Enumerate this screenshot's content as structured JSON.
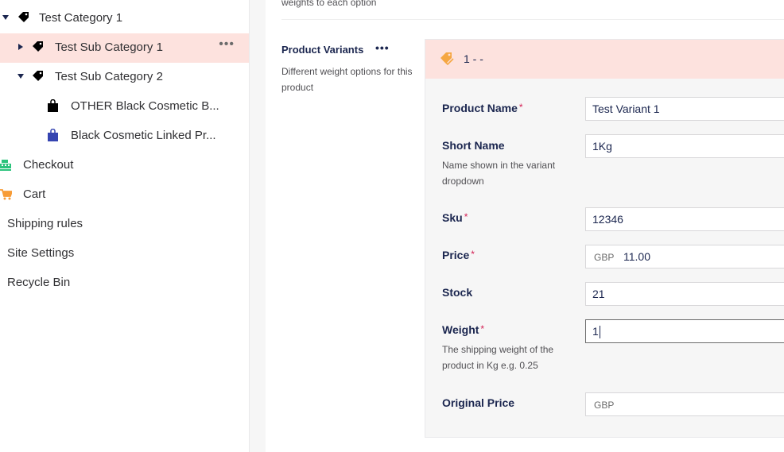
{
  "sidebar": {
    "items": [
      {
        "label": "Test Category 1",
        "icon": "tag-icon"
      },
      {
        "label": "Test Sub Category 1",
        "icon": "tag-icon",
        "active": true,
        "more": "•••"
      },
      {
        "label": "Test Sub Category 2",
        "icon": "tag-icon"
      },
      {
        "label": "OTHER Black Cosmetic B...",
        "icon": "shopping-bag-icon"
      },
      {
        "label": "Black Cosmetic Linked Pr...",
        "icon": "shopping-bag-icon"
      },
      {
        "label": "Checkout",
        "icon": "cash-register-icon"
      },
      {
        "label": "Cart",
        "icon": "cart-icon"
      },
      {
        "label": "Shipping rules"
      },
      {
        "label": "Site Settings"
      },
      {
        "label": "Recycle Bin"
      }
    ]
  },
  "main": {
    "top_desc": "weights to each option",
    "property": {
      "title": "Product Variants",
      "more": "•••",
      "description": "Different weight options for this product"
    },
    "variant": {
      "header_title": "1 - -",
      "fields": {
        "product_name": {
          "label": "Product Name",
          "required": "*",
          "value": "Test Variant 1"
        },
        "short_name": {
          "label": "Short Name",
          "description": "Name shown in the variant dropdown",
          "value": "1Kg"
        },
        "sku": {
          "label": "Sku",
          "required": "*",
          "value": "12346"
        },
        "price": {
          "label": "Price",
          "required": "*",
          "currency": "GBP",
          "value": "11.00"
        },
        "stock": {
          "label": "Stock",
          "value": "21"
        },
        "weight": {
          "label": "Weight",
          "required": "*",
          "description": "The shipping weight of the product in Kg e.g. 0.25",
          "value": "1"
        },
        "original_price": {
          "label": "Original Price",
          "currency": "GBP",
          "value": ""
        }
      }
    }
  },
  "colors": {
    "active_row": "#fde2de",
    "required": "#d42054",
    "tag_orange": "#f5a742",
    "bag_blue": "#3544b1",
    "checkout_green": "#2bc37c",
    "cart_orange": "#f79c37"
  }
}
